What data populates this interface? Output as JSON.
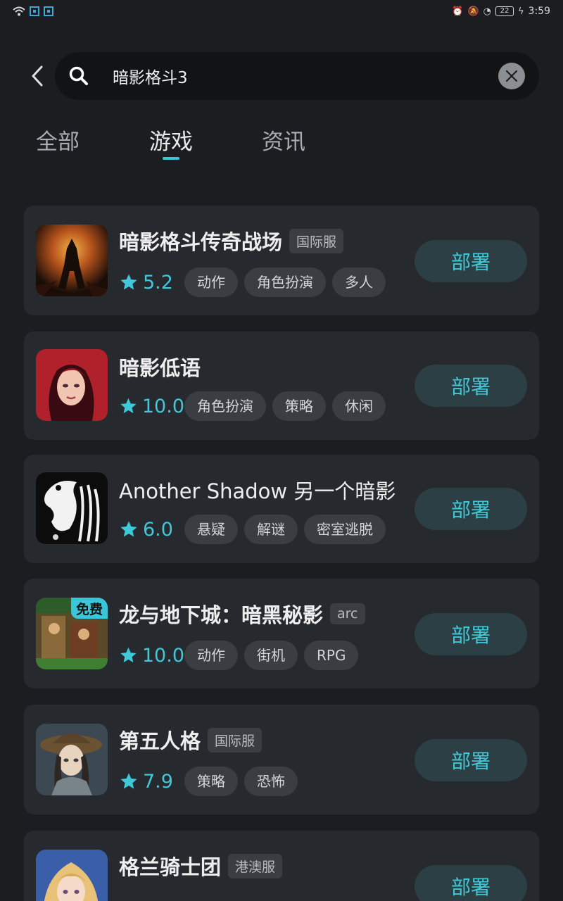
{
  "status_bar": {
    "time": "3:59",
    "battery": "22",
    "icons": [
      "wifi-icon",
      "qr-icon",
      "qr-icon",
      "alarm-icon",
      "mute-icon",
      "speed-icon",
      "battery-icon",
      "charging-icon"
    ]
  },
  "search": {
    "query": "暗影格斗3"
  },
  "tabs": [
    {
      "label": "全部",
      "active": false
    },
    {
      "label": "游戏",
      "active": true
    },
    {
      "label": "资讯",
      "active": false
    }
  ],
  "colors": {
    "accent": "#39c6d8",
    "background": "#1b1d20",
    "card": "#26292e",
    "tag": "#3a3d42",
    "deploy_button": "#2b3f44"
  },
  "games": [
    {
      "name": "暗影格斗传奇战场",
      "badge": "国际服",
      "rating": "5.2",
      "tags": [
        "动作",
        "角色扮演",
        "多人"
      ],
      "button": "部署",
      "icon": "dark-warrior-icon"
    },
    {
      "name": "暗影低语",
      "badge": "",
      "rating": "10.0",
      "tags": [
        "角色扮演",
        "策略",
        "休闲"
      ],
      "button": "部署",
      "icon": "red-hair-girl-icon"
    },
    {
      "name": "Another Shadow 另一个暗影",
      "badge": "",
      "rating": "6.0",
      "tags": [
        "悬疑",
        "解谜",
        "密室逃脱"
      ],
      "button": "部署",
      "icon": "shadow-bird-icon"
    },
    {
      "name": "龙与地下城：暗黑秘影",
      "badge": "arc",
      "rating": "10.0",
      "tags": [
        "动作",
        "街机",
        "RPG"
      ],
      "button": "部署",
      "icon": "arcade-cover-icon",
      "free_label": "免费"
    },
    {
      "name": "第五人格",
      "badge": "国际服",
      "rating": "7.9",
      "tags": [
        "策略",
        "恐怖"
      ],
      "button": "部署",
      "icon": "straw-hat-girl-icon"
    },
    {
      "name": "格兰骑士团",
      "badge": "港澳服",
      "rating": "",
      "tags": [],
      "button": "部署",
      "icon": "blonde-knight-icon"
    }
  ]
}
